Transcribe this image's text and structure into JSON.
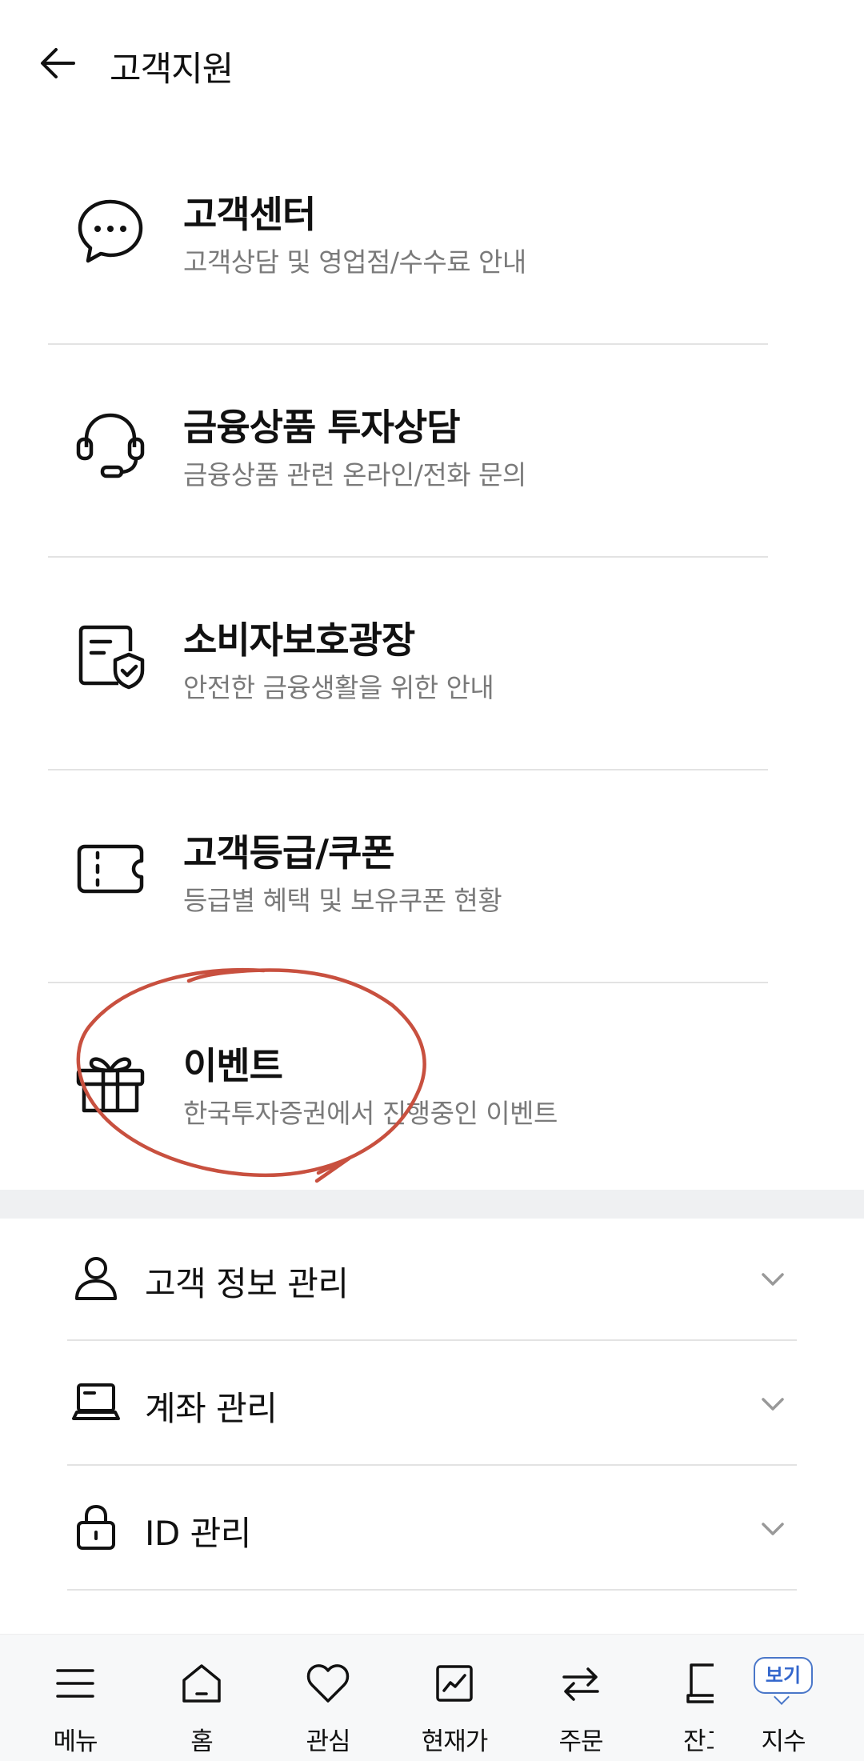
{
  "header": {
    "title": "고객지원"
  },
  "support_items": [
    {
      "title": "고객센터",
      "subtitle": "고객상담 및 영업점/수수료 안내",
      "icon": "chat-bubble-icon"
    },
    {
      "title": "금융상품 투자상담",
      "subtitle": "금융상품 관련 온라인/전화 문의",
      "icon": "headset-icon"
    },
    {
      "title": "소비자보호광장",
      "subtitle": "안전한 금융생활을 위한 안내",
      "icon": "shield-document-icon"
    },
    {
      "title": "고객등급/쿠폰",
      "subtitle": "등급별 혜택 및 보유쿠폰 현황",
      "icon": "coupon-ticket-icon"
    },
    {
      "title": "이벤트",
      "subtitle": "한국투자증권에서 진행중인 이벤트",
      "icon": "gift-icon"
    }
  ],
  "account_sections": [
    {
      "label": "고객 정보 관리",
      "icon": "person-icon"
    },
    {
      "label": "계좌 관리",
      "icon": "laptop-icon"
    },
    {
      "label": "ID 관리",
      "icon": "lock-icon"
    }
  ],
  "bottom_nav": {
    "items": [
      {
        "label": "메뉴",
        "icon": "hamburger-icon"
      },
      {
        "label": "홈",
        "icon": "home-icon"
      },
      {
        "label": "관심",
        "icon": "heart-icon"
      },
      {
        "label": "현재가",
        "icon": "chart-icon"
      },
      {
        "label": "주문",
        "icon": "swap-arrows-icon"
      }
    ],
    "partial_label": "잔고",
    "index_badge": "보기",
    "index_label": "지수"
  },
  "colors": {
    "annotation_stroke": "#c8503f",
    "divider": "#e3e3e3",
    "section_gap": "#eff0f2",
    "badge_blue": "#3366cc"
  }
}
